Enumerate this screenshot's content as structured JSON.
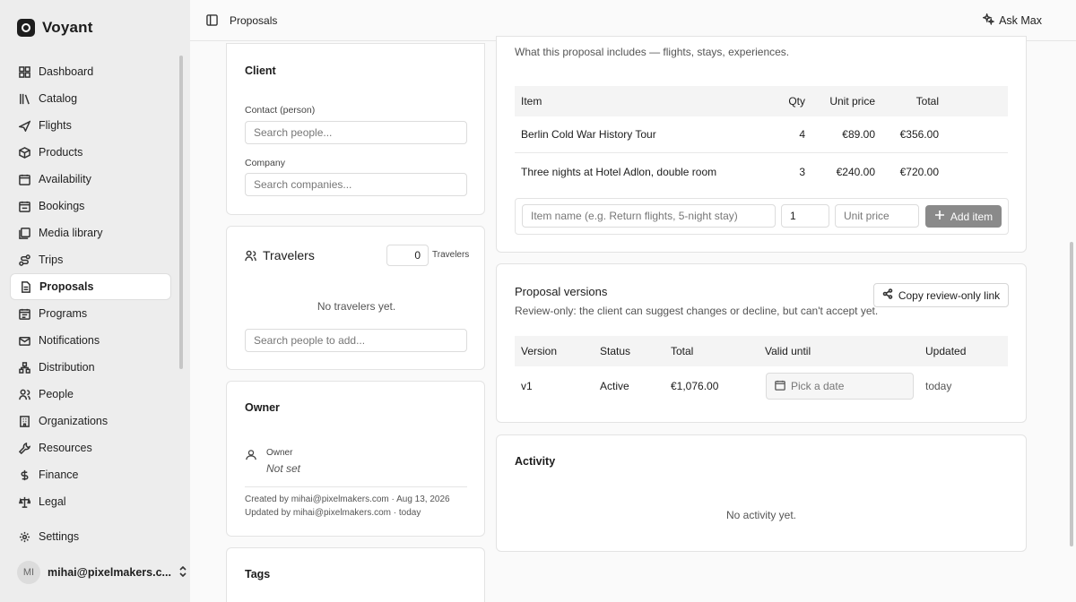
{
  "brand": {
    "name": "Voyant"
  },
  "nav": [
    {
      "label": "Dashboard",
      "icon": "dashboard-icon",
      "active": false
    },
    {
      "label": "Catalog",
      "icon": "catalog-icon",
      "active": false
    },
    {
      "label": "Flights",
      "icon": "plane-icon",
      "active": false
    },
    {
      "label": "Products",
      "icon": "package-icon",
      "active": false
    },
    {
      "label": "Availability",
      "icon": "calendar-icon",
      "active": false
    },
    {
      "label": "Bookings",
      "icon": "calendar-check-icon",
      "active": false
    },
    {
      "label": "Media library",
      "icon": "media-icon",
      "active": false
    },
    {
      "label": "Trips",
      "icon": "route-icon",
      "active": false
    },
    {
      "label": "Proposals",
      "icon": "document-icon",
      "active": true
    },
    {
      "label": "Programs",
      "icon": "calendar-list-icon",
      "active": false
    },
    {
      "label": "Notifications",
      "icon": "mail-icon",
      "active": false
    },
    {
      "label": "Distribution",
      "icon": "network-icon",
      "active": false
    },
    {
      "label": "People",
      "icon": "people-icon",
      "active": false
    },
    {
      "label": "Organizations",
      "icon": "building-icon",
      "active": false
    },
    {
      "label": "Resources",
      "icon": "wrench-icon",
      "active": false
    },
    {
      "label": "Finance",
      "icon": "dollar-icon",
      "active": false
    },
    {
      "label": "Legal",
      "icon": "scale-icon",
      "active": false
    }
  ],
  "settings": {
    "label": "Settings"
  },
  "user": {
    "initials": "MI",
    "email": "mihai@pixelmakers.c..."
  },
  "topbar": {
    "breadcrumb": "Proposals",
    "ask_label": "Ask Max"
  },
  "client": {
    "title": "Client",
    "contact_label": "Contact (person)",
    "contact_placeholder": "Search people...",
    "company_label": "Company",
    "company_placeholder": "Search companies..."
  },
  "travelers": {
    "title": "Travelers",
    "count": "0",
    "count_label": "Travelers",
    "empty": "No travelers yet.",
    "search_placeholder": "Search people to add..."
  },
  "owner": {
    "title": "Owner",
    "label": "Owner",
    "value": "Not set",
    "created": "Created by mihai@pixelmakers.com · Aug 13, 2026",
    "updated": "Updated by mihai@pixelmakers.com · today"
  },
  "tags": {
    "title": "Tags"
  },
  "items": {
    "subtitle": "What this proposal includes — flights, stays, experiences.",
    "columns": {
      "item": "Item",
      "qty": "Qty",
      "unit_price": "Unit price",
      "total": "Total"
    },
    "rows": [
      {
        "name": "Berlin Cold War History Tour",
        "qty": "4",
        "unit_price": "€89.00",
        "total": "€356.00"
      },
      {
        "name": "Three nights at Hotel Adlon, double room",
        "qty": "3",
        "unit_price": "€240.00",
        "total": "€720.00"
      }
    ],
    "new_item_placeholder": "Item name (e.g. Return flights, 5-night stay)",
    "new_qty_value": "1",
    "new_price_placeholder": "Unit price",
    "add_label": "Add item"
  },
  "versions": {
    "title": "Proposal versions",
    "subtitle": "Review-only: the client can suggest changes or decline, but can't accept yet.",
    "copy_label": "Copy review-only link",
    "columns": {
      "version": "Version",
      "status": "Status",
      "total": "Total",
      "valid_until": "Valid until",
      "updated": "Updated"
    },
    "rows": [
      {
        "version": "v1",
        "status": "Active",
        "total": "€1,076.00",
        "valid_placeholder": "Pick a date",
        "updated": "today"
      }
    ]
  },
  "activity": {
    "title": "Activity",
    "empty": "No activity yet."
  }
}
